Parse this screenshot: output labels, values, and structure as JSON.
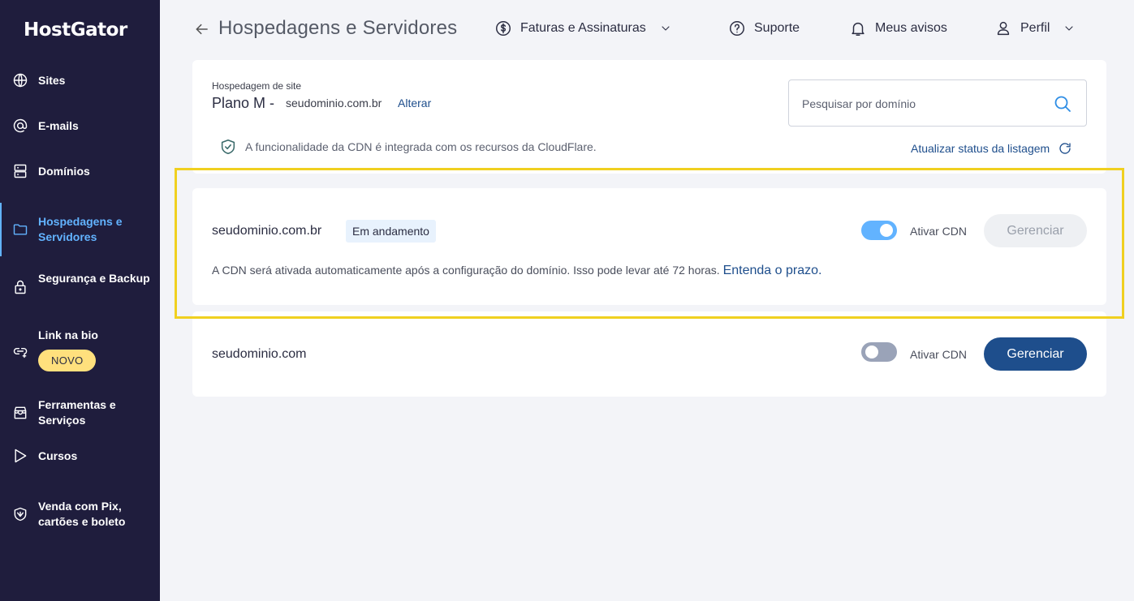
{
  "sidebar": {
    "logo": "HostGator",
    "items": [
      {
        "label": "Sites",
        "icon": "globe-icon"
      },
      {
        "label": "E-mails",
        "icon": "at-icon"
      },
      {
        "label": "Domínios",
        "icon": "server-icon"
      },
      {
        "label": "Hospedagens e Servidores",
        "icon": "folder-icon",
        "active": true
      },
      {
        "label": "Segurança e Backup",
        "icon": "lock-icon"
      },
      {
        "label": "Link na bio",
        "icon": "link-icon",
        "badge": "NOVO"
      },
      {
        "label": "Ferramentas e Serviços",
        "icon": "store-icon"
      },
      {
        "label": "Cursos",
        "icon": "play-icon"
      },
      {
        "label": "Venda com Pix, cartões e boleto",
        "icon": "shield-bird-icon"
      }
    ]
  },
  "header": {
    "title": "Hospedagens e Servidores",
    "billing": "Faturas e Assinaturas",
    "support": "Suporte",
    "notices": "Meus avisos",
    "profile": "Perfil"
  },
  "plan": {
    "caption": "Hospedagem de site",
    "name": "Plano M -",
    "domain": "seudominio.com.br",
    "change": "Alterar"
  },
  "search": {
    "placeholder": "Pesquisar por domínio"
  },
  "cdn_info": "A funcionalidade da CDN é integrada com os recursos da CloudFlare.",
  "refresh": "Atualizar status da listagem",
  "domains": [
    {
      "name": "seudominio.com.br",
      "status": "Em andamento",
      "toggle_label": "Ativar CDN",
      "cdn_enabled": true,
      "manage": "Gerenciar",
      "note": "A CDN será ativada automaticamente após a configuração do domínio. Isso pode levar até 72 horas.",
      "note_link": "Entenda o prazo."
    },
    {
      "name": "seudominio.com",
      "toggle_label": "Ativar CDN",
      "cdn_enabled": false,
      "manage": "Gerenciar"
    }
  ],
  "colors": {
    "sidebar_bg": "#1f1d3d",
    "accent": "#62b3ff",
    "primary_button": "#1e4e8c",
    "highlight": "#f0d020"
  }
}
